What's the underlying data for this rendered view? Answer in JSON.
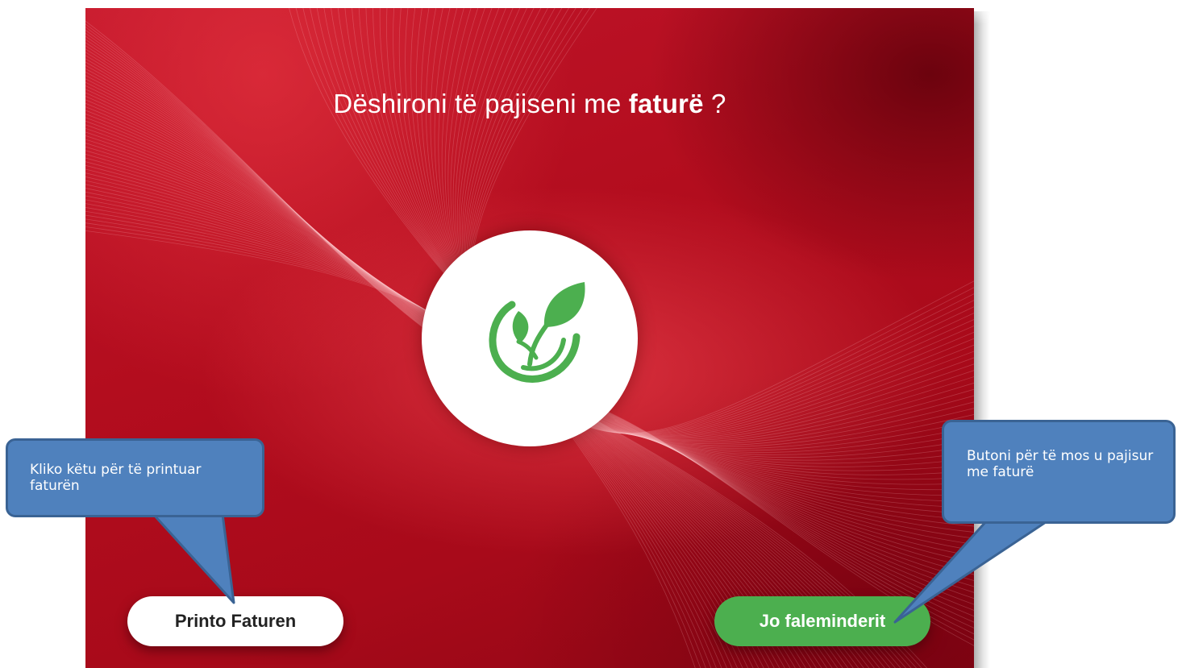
{
  "screen": {
    "question_regular": "Dëshironi të pajiseni me ",
    "question_strong": "faturë",
    "question_tail": " ?",
    "logo_icon": "leaf-swirl-icon",
    "colors": {
      "background": "#b30d1e",
      "logo_green": "#4caf4f",
      "no_button": "#4caf4f",
      "print_button": "#ffffff"
    }
  },
  "buttons": {
    "print_label": "Printo Faturen",
    "no_label": "Jo faleminderit"
  },
  "callouts": {
    "left_text": "Kliko këtu për të printuar faturën",
    "right_text": "Butoni për të mos u pajisur me faturë",
    "color": "#4f81bd"
  }
}
